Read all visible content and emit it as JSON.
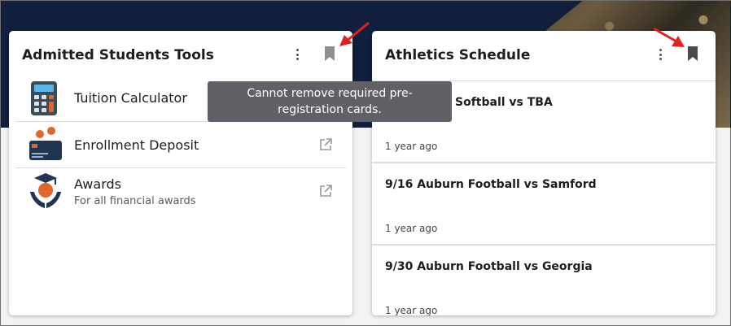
{
  "left_card": {
    "title": "Admitted Students Tools",
    "items": [
      {
        "label": "Tuition Calculator",
        "icon": "calculator-icon"
      },
      {
        "label": "Enrollment Deposit",
        "icon": "bank-card-icon"
      },
      {
        "label": "Awards",
        "sub": "For all financial awards",
        "icon": "graduation-money-icon"
      }
    ]
  },
  "right_card": {
    "title": "Athletics Schedule",
    "events": [
      {
        "title": "Softball vs TBA",
        "time": "1 year ago"
      },
      {
        "title": "9/16 Auburn Football vs Samford",
        "time": "1 year ago"
      },
      {
        "title": "9/30 Auburn Football vs Georgia",
        "time": "1 year ago"
      }
    ]
  },
  "tooltip": {
    "text": "Cannot remove required pre-registration cards."
  },
  "colors": {
    "navy": "#0f1f3c",
    "arrow": "#e3211c",
    "tooltip": "#5f6166",
    "orange": "#e0662b"
  }
}
